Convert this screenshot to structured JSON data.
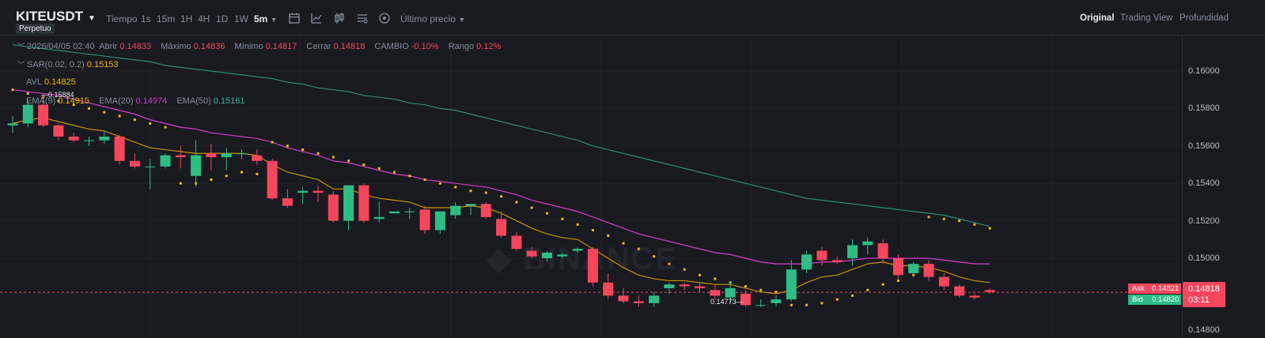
{
  "header": {
    "symbol": "KITEUSDT",
    "contract": "Perpetuo",
    "timeframes": [
      "Tiempo",
      "1s",
      "15m",
      "1H",
      "4H",
      "1D",
      "1W",
      "5m"
    ],
    "active_timeframe": "5m",
    "price_type": "Último precio",
    "views": [
      "Original",
      "Trading View",
      "Profundidad"
    ],
    "active_view": "Original"
  },
  "ohlc": {
    "date": "2026/04/05 02:40",
    "open_label": "Abrir",
    "open": "0.14833",
    "high_label": "Máximo",
    "high": "0.14836",
    "low_label": "Mínimo",
    "low": "0.14817",
    "close_label": "Cerrar",
    "close": "0.14818",
    "change_label": "CAMBIO",
    "change": "-0.10%",
    "range_label": "Rango",
    "range": "0.12%"
  },
  "indicators": {
    "sar_label": "SAR(0.02, 0.2)",
    "sar": "0.15153",
    "avl_label": "AVL",
    "avl": "0.14825",
    "ema9_label": "EMA(9)",
    "ema9": "0.14915",
    "ema20_label": "EMA(20)",
    "ema20": "0.14974",
    "ema50_label": "EMA(50)",
    "ema50": "0.15161"
  },
  "price_axis": [
    "0.16000",
    "0.15800",
    "0.15600",
    "0.15400",
    "0.15200",
    "0.15000",
    "0.14800"
  ],
  "annotations": {
    "high": "0.15884",
    "low": "0.14773"
  },
  "ask_label": "Ask",
  "ask": "0.14821",
  "bid_label": "Bid",
  "bid": "0.14820",
  "last_price": "0.14818",
  "countdown": "03:11",
  "watermark": "BINANCE",
  "colors": {
    "up": "#2ebd85",
    "down": "#f6465d",
    "ema9": "#c99400",
    "ema20": "#d63dc7",
    "ema50": "#2c8a78",
    "sar": "#f0b90b"
  },
  "chart_data": {
    "type": "candlestick",
    "ylim": [
      0.147,
      0.162
    ],
    "candles": [
      [
        0.1571,
        0.1576,
        0.1567,
        0.1572
      ],
      [
        0.1572,
        0.1584,
        0.157,
        0.1582
      ],
      [
        0.1582,
        0.1588,
        0.157,
        0.1571
      ],
      [
        0.1571,
        0.1572,
        0.1563,
        0.1565
      ],
      [
        0.1565,
        0.1567,
        0.1562,
        0.1563
      ],
      [
        0.1563,
        0.1565,
        0.156,
        0.1563
      ],
      [
        0.1563,
        0.1568,
        0.1561,
        0.1565
      ],
      [
        0.1565,
        0.1566,
        0.155,
        0.1552
      ],
      [
        0.1552,
        0.1556,
        0.1548,
        0.1549
      ],
      [
        0.1549,
        0.1553,
        0.1537,
        0.1549
      ],
      [
        0.1549,
        0.1556,
        0.1548,
        0.1555
      ],
      [
        0.1555,
        0.156,
        0.1548,
        0.1554
      ],
      [
        0.1544,
        0.1563,
        0.1538,
        0.1555
      ],
      [
        0.1556,
        0.1561,
        0.1547,
        0.1554
      ],
      [
        0.1554,
        0.1559,
        0.1547,
        0.1556
      ],
      [
        0.1556,
        0.1558,
        0.1553,
        0.1556
      ],
      [
        0.1555,
        0.1558,
        0.155,
        0.1552
      ],
      [
        0.1552,
        0.1553,
        0.1531,
        0.1532
      ],
      [
        0.1532,
        0.1537,
        0.1527,
        0.1528
      ],
      [
        0.1535,
        0.1538,
        0.1529,
        0.1536
      ],
      [
        0.1536,
        0.1539,
        0.153,
        0.1535
      ],
      [
        0.1534,
        0.1536,
        0.1519,
        0.152
      ],
      [
        0.152,
        0.1538,
        0.1515,
        0.1539
      ],
      [
        0.1539,
        0.154,
        0.1519,
        0.152
      ],
      [
        0.1521,
        0.153,
        0.1519,
        0.1522
      ],
      [
        0.1524,
        0.1525,
        0.1524,
        0.1525
      ],
      [
        0.1525,
        0.1527,
        0.1521,
        0.1525
      ],
      [
        0.1526,
        0.1528,
        0.1513,
        0.1515
      ],
      [
        0.1515,
        0.1523,
        0.1513,
        0.1525
      ],
      [
        0.1523,
        0.153,
        0.1521,
        0.1528
      ],
      [
        0.1528,
        0.1529,
        0.1523,
        0.1529
      ],
      [
        0.1529,
        0.153,
        0.1521,
        0.1522
      ],
      [
        0.1521,
        0.1525,
        0.1511,
        0.1512
      ],
      [
        0.1512,
        0.1514,
        0.1504,
        0.1505
      ],
      [
        0.1504,
        0.1506,
        0.15,
        0.1501
      ],
      [
        0.15,
        0.1504,
        0.1498,
        0.1503
      ],
      [
        0.1501,
        0.1503,
        0.15,
        0.1502
      ],
      [
        0.1504,
        0.1506,
        0.1503,
        0.1505
      ],
      [
        0.1505,
        0.1506,
        0.1485,
        0.1487
      ],
      [
        0.1487,
        0.1492,
        0.1478,
        0.148
      ],
      [
        0.148,
        0.1484,
        0.1476,
        0.1477
      ],
      [
        0.1477,
        0.148,
        0.1474,
        0.1476
      ],
      [
        0.1476,
        0.1482,
        0.1474,
        0.148
      ],
      [
        0.1484,
        0.1487,
        0.1481,
        0.1486
      ],
      [
        0.1486,
        0.1487,
        0.1483,
        0.1485
      ],
      [
        0.1485,
        0.1487,
        0.1482,
        0.1484
      ],
      [
        0.1483,
        0.1486,
        0.1478,
        0.148
      ],
      [
        0.1479,
        0.1488,
        0.1476,
        0.1484
      ],
      [
        0.1481,
        0.1483,
        0.1474,
        0.1475
      ],
      [
        0.1475,
        0.1478,
        0.1474,
        0.1475
      ],
      [
        0.1476,
        0.148,
        0.1474,
        0.1478
      ],
      [
        0.1478,
        0.1499,
        0.1477,
        0.1494
      ],
      [
        0.1494,
        0.1504,
        0.1492,
        0.1502
      ],
      [
        0.1504,
        0.1506,
        0.1496,
        0.1499
      ],
      [
        0.1499,
        0.1501,
        0.1497,
        0.1498
      ],
      [
        0.15,
        0.151,
        0.1496,
        0.1507
      ],
      [
        0.1507,
        0.1511,
        0.1502,
        0.1509
      ],
      [
        0.1508,
        0.151,
        0.1497,
        0.15
      ],
      [
        0.15,
        0.1502,
        0.1489,
        0.1491
      ],
      [
        0.1492,
        0.1498,
        0.149,
        0.1497
      ],
      [
        0.1497,
        0.1499,
        0.1488,
        0.149
      ],
      [
        0.149,
        0.1492,
        0.1483,
        0.1485
      ],
      [
        0.1485,
        0.1486,
        0.1479,
        0.148
      ],
      [
        0.148,
        0.1481,
        0.1478,
        0.1479
      ],
      [
        0.1483,
        0.1484,
        0.1481,
        0.1482
      ]
    ],
    "ema9": [
      0.1572,
      0.1574,
      0.1575,
      0.1573,
      0.1571,
      0.1569,
      0.1568,
      0.1565,
      0.1562,
      0.1559,
      0.1558,
      0.1557,
      0.1556,
      0.1556,
      0.1556,
      0.1556,
      0.1555,
      0.155,
      0.1546,
      0.1544,
      0.1542,
      0.1537,
      0.1537,
      0.1534,
      0.1532,
      0.1531,
      0.153,
      0.1527,
      0.1527,
      0.1527,
      0.1528,
      0.1527,
      0.1524,
      0.152,
      0.1516,
      0.1513,
      0.1511,
      0.151,
      0.1505,
      0.15,
      0.1495,
      0.1491,
      0.1489,
      0.1488,
      0.1488,
      0.1487,
      0.1486,
      0.1486,
      0.1484,
      0.1482,
      0.1481,
      0.1483,
      0.1487,
      0.149,
      0.1491,
      0.1494,
      0.1497,
      0.1498,
      0.1496,
      0.1496,
      0.1495,
      0.1493,
      0.149,
      0.1488,
      0.1487
    ],
    "ema20": [
      0.159,
      0.1589,
      0.1588,
      0.1587,
      0.1585,
      0.1583,
      0.1581,
      0.1579,
      0.1577,
      0.1574,
      0.1572,
      0.157,
      0.1569,
      0.1567,
      0.1566,
      0.1565,
      0.1564,
      0.1562,
      0.1559,
      0.1557,
      0.1555,
      0.1552,
      0.1551,
      0.1549,
      0.1547,
      0.1545,
      0.1544,
      0.1542,
      0.1541,
      0.154,
      0.1539,
      0.1538,
      0.1536,
      0.1534,
      0.1531,
      0.1529,
      0.1527,
      0.1525,
      0.1522,
      0.1519,
      0.1516,
      0.1513,
      0.1511,
      0.1509,
      0.1507,
      0.1505,
      0.1503,
      0.1502,
      0.15,
      0.1498,
      0.1497,
      0.1497,
      0.1497,
      0.1498,
      0.1498,
      0.1499,
      0.15,
      0.15,
      0.15,
      0.15,
      0.15,
      0.1499,
      0.1498,
      0.1497,
      0.1497
    ],
    "ema50": [
      0.1614,
      0.1613,
      0.1612,
      0.1611,
      0.161,
      0.1609,
      0.1608,
      0.1607,
      0.1606,
      0.1605,
      0.1603,
      0.1602,
      0.1601,
      0.16,
      0.1599,
      0.1598,
      0.1597,
      0.1596,
      0.1594,
      0.1593,
      0.1591,
      0.159,
      0.1589,
      0.1587,
      0.1586,
      0.1585,
      0.1583,
      0.1582,
      0.158,
      0.1579,
      0.1577,
      0.1575,
      0.1573,
      0.1571,
      0.1569,
      0.1567,
      0.1565,
      0.1563,
      0.156,
      0.1558,
      0.1556,
      0.1554,
      0.1552,
      0.155,
      0.1548,
      0.1546,
      0.1544,
      0.1542,
      0.154,
      0.1538,
      0.1536,
      0.1534,
      0.1532,
      0.1531,
      0.153,
      0.1529,
      0.1528,
      0.1527,
      0.1526,
      0.1525,
      0.1524,
      0.1523,
      0.1521,
      0.1519,
      0.1517
    ],
    "sar": [
      0.159,
      0.1588,
      0.1586,
      0.1584,
      0.1582,
      0.158,
      0.1578,
      0.1576,
      0.1574,
      0.1572,
      0.157,
      0.154,
      0.154,
      0.1542,
      0.1544,
      0.1546,
      0.1545,
      0.1562,
      0.156,
      0.1558,
      0.1556,
      0.1554,
      0.1552,
      0.155,
      0.1548,
      0.1546,
      0.1544,
      0.1542,
      0.154,
      0.1538,
      0.1536,
      0.1535,
      0.1533,
      0.153,
      0.1527,
      0.1524,
      0.1521,
      0.1518,
      0.1515,
      0.1512,
      0.1508,
      0.1505,
      0.1501,
      0.1497,
      0.1494,
      0.1491,
      0.1489,
      0.1487,
      0.1485,
      0.1483,
      0.1482,
      0.1475,
      0.1475,
      0.1476,
      0.1478,
      0.148,
      0.1483,
      0.1486,
      0.1488,
      0.1491,
      0.1522,
      0.1521,
      0.152,
      0.1518,
      0.1516
    ]
  }
}
